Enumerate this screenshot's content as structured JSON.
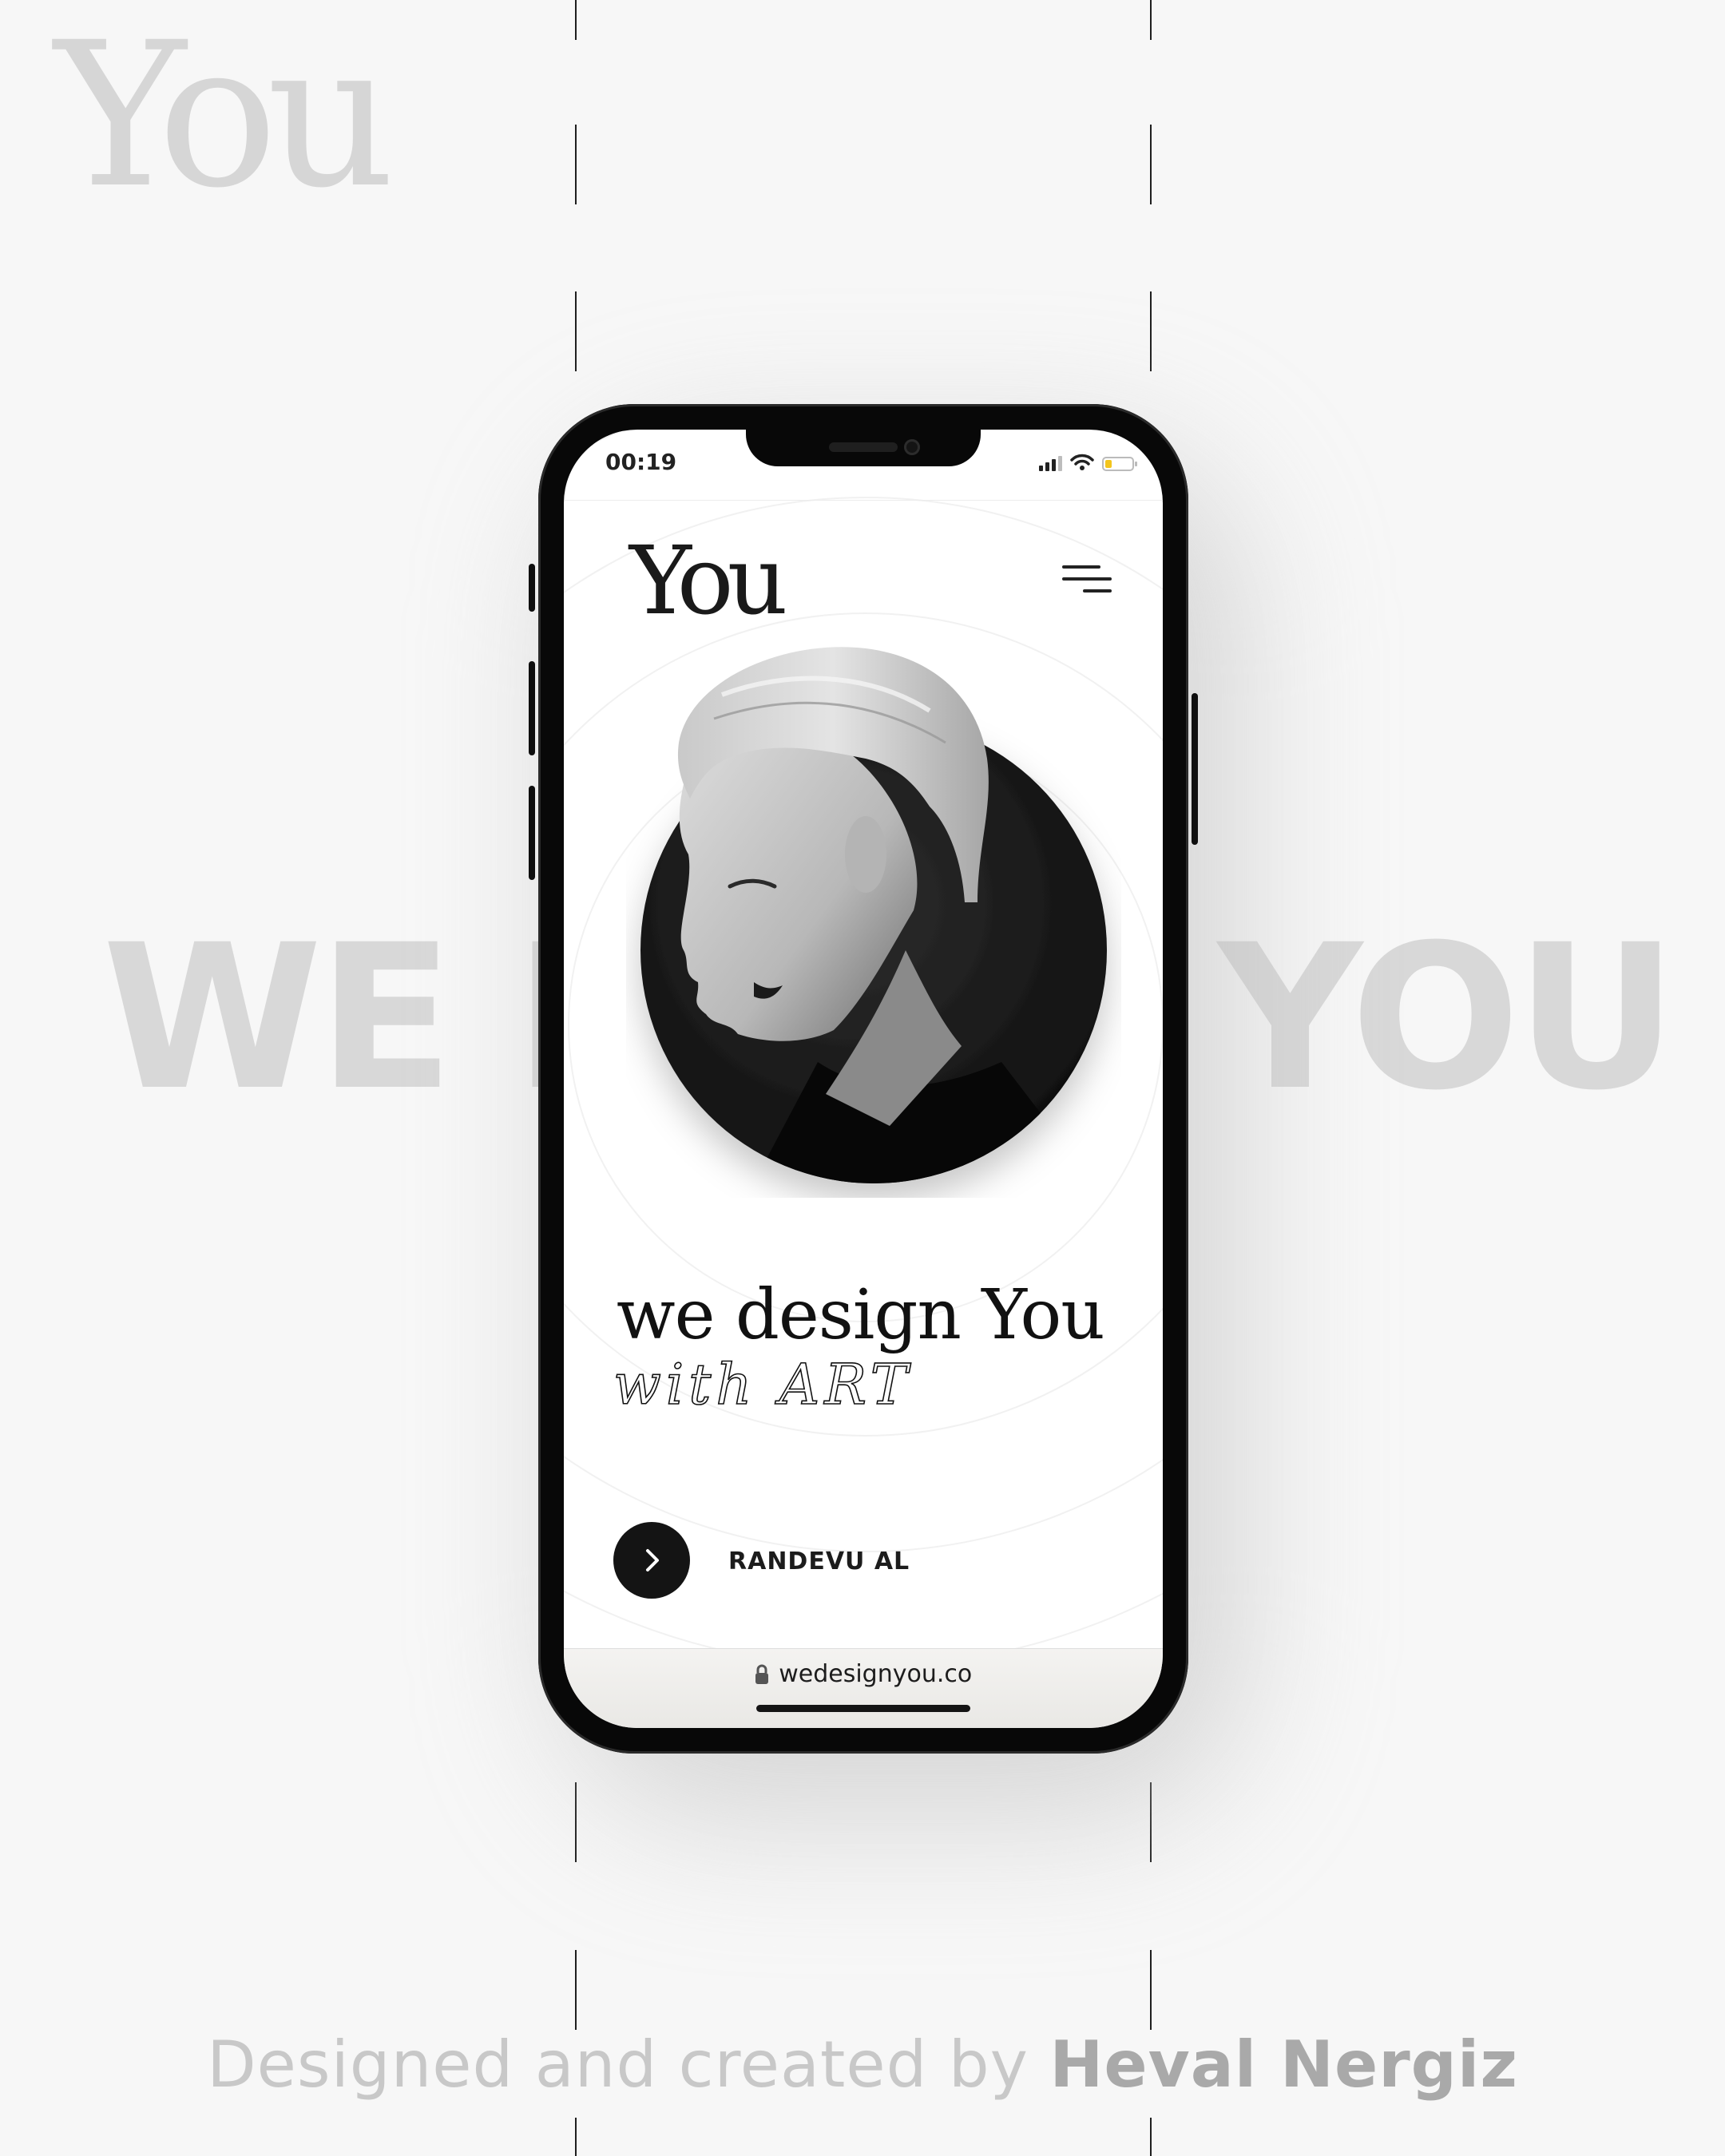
{
  "poster": {
    "corner_logo": "You",
    "bg_left": "WE D",
    "bg_right": "YOU",
    "credit_prefix": "Designed and created by ",
    "credit_name": "Heval Nergiz"
  },
  "status_bar": {
    "time": "00:19",
    "battery_level": 0.25
  },
  "site": {
    "logo": "You",
    "headline": "we design You",
    "tagline": "with ART",
    "cta_label": "RANDEVU AL",
    "url": "wedesignyou.co"
  },
  "colors": {
    "background": "#f7f7f7",
    "phone_frame": "#080808",
    "screen": "#ffffff",
    "ink": "#111111",
    "watermark": "#d8d8d8",
    "battery": "#f3c51d"
  },
  "icons": {
    "menu": "menu-lines-icon",
    "cta": "chevron-right-icon",
    "lock": "lock-icon",
    "wifi": "wifi-icon",
    "signal": "cell-signal-icon",
    "battery": "battery-icon"
  }
}
